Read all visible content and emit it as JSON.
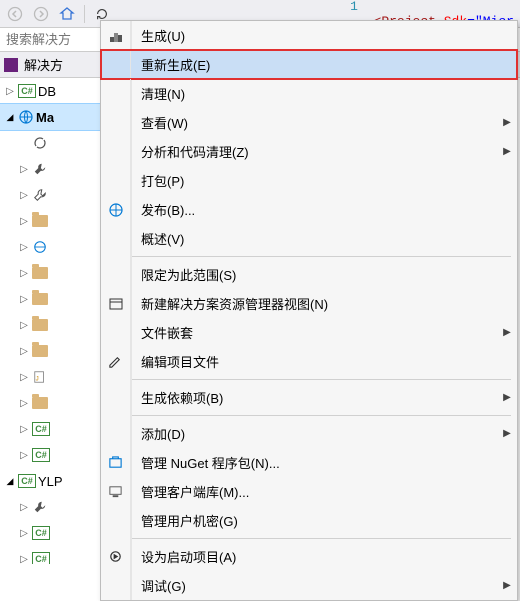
{
  "toolbar": {
    "code": {
      "linenum": "1",
      "lt": "<",
      "tag": "Project",
      "sp": " ",
      "attr": "Sdk",
      "eq": "=",
      "q": "\"",
      "val": "Micr"
    }
  },
  "search": {
    "placeholder": "搜索解决方"
  },
  "solution_explorer": {
    "header": "解决方"
  },
  "tree": {
    "db": "DB",
    "ma": "Ma",
    "ylp": "YLP",
    "cs_badge": "C#"
  },
  "menu": {
    "build": "生成(U)",
    "rebuild": "重新生成(E)",
    "clean": "清理(N)",
    "view": "查看(W)",
    "analyze": "分析和代码清理(Z)",
    "pack": "打包(P)",
    "publish": "发布(B)...",
    "overview": "概述(V)",
    "scope": "限定为此范围(S)",
    "newview": "新建解决方案资源管理器视图(N)",
    "filenest": "文件嵌套",
    "editproj": "编辑项目文件",
    "builddep": "生成依赖项(B)",
    "add": "添加(D)",
    "nuget": "管理 NuGet 程序包(N)...",
    "clientlib": "管理客户端库(M)...",
    "secrets": "管理用户机密(G)",
    "startup": "设为启动项目(A)",
    "debug": "调试(G)"
  }
}
